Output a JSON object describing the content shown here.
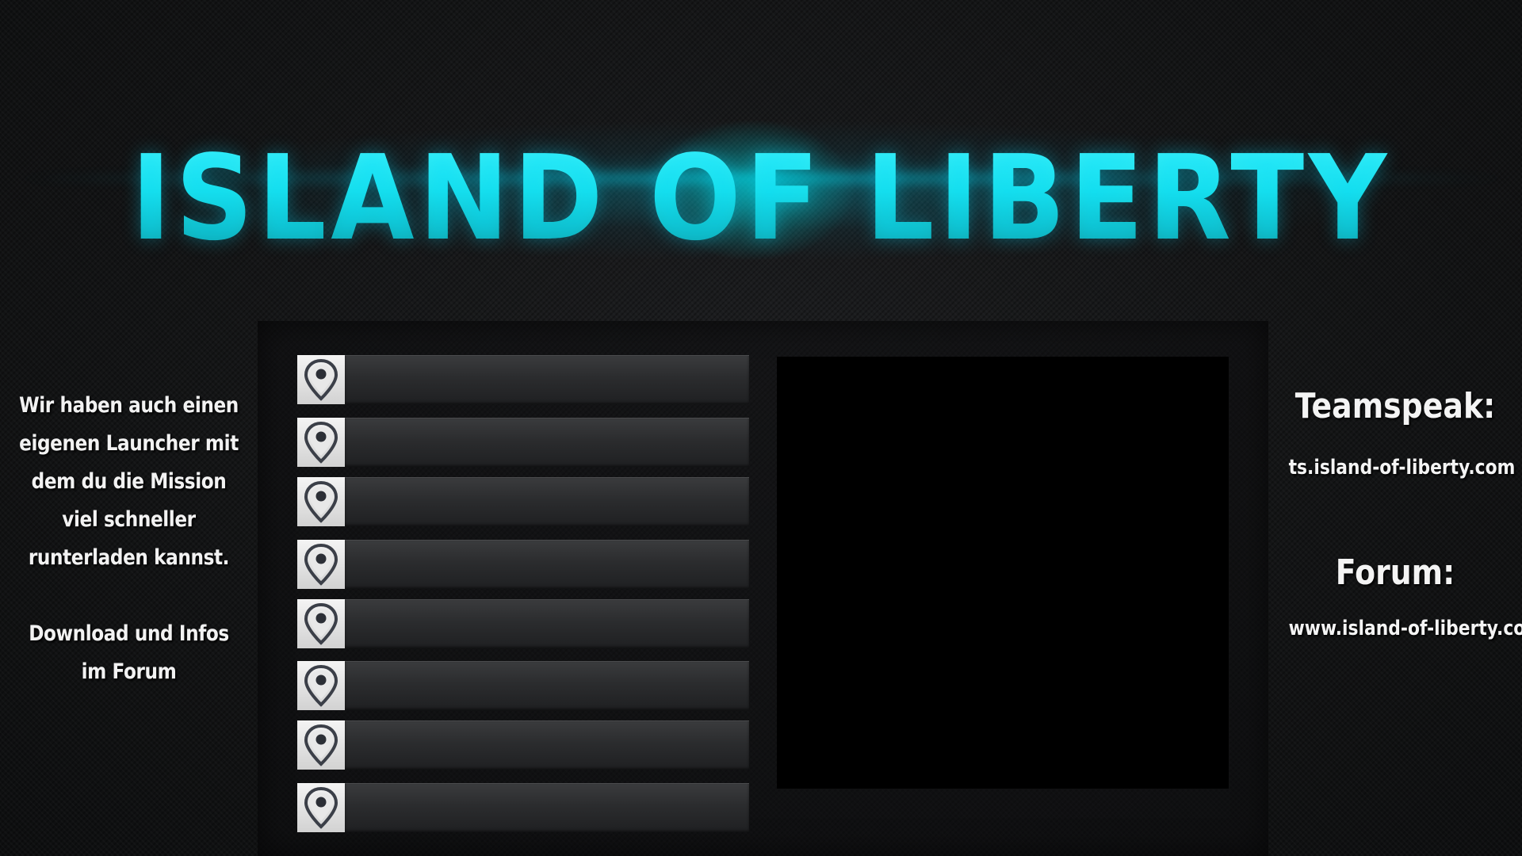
{
  "header": {
    "title": "ISLAND OF LIBERTY"
  },
  "colors": {
    "accent": "#20e4ee",
    "background": "#121314",
    "text": "#f2f2f2"
  },
  "locations": [
    {
      "label": "",
      "icon": "map-pin-icon"
    },
    {
      "label": "",
      "icon": "map-pin-icon"
    },
    {
      "label": "",
      "icon": "map-pin-icon"
    },
    {
      "label": "",
      "icon": "map-pin-icon"
    },
    {
      "label": "",
      "icon": "map-pin-icon"
    },
    {
      "label": "",
      "icon": "map-pin-icon"
    },
    {
      "label": "",
      "icon": "map-pin-icon"
    },
    {
      "label": "",
      "icon": "map-pin-icon"
    }
  ],
  "left_info": {
    "lines": [
      "Wir haben auch einen",
      "eigenen Launcher mit",
      "dem du die Mission",
      "viel schneller",
      "runterladen kannst."
    ],
    "lines2": [
      "Download und Infos",
      "im Forum"
    ]
  },
  "right_info": {
    "teamspeak_heading": "Teamspeak:",
    "teamspeak_value": "ts.island-of-liberty.com",
    "forum_heading": "Forum:",
    "forum_value": "www.island-of-liberty.com"
  }
}
